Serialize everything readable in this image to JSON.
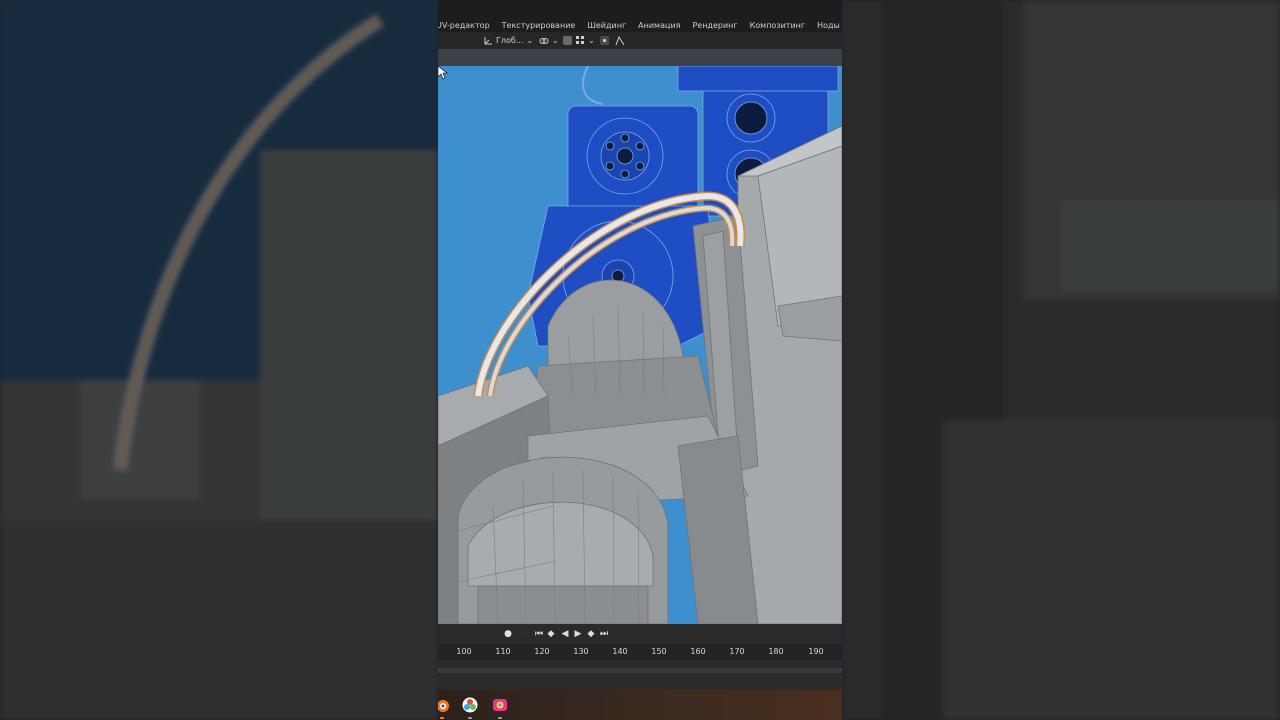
{
  "workspace_tabs": [
    "UV-редактор",
    "Текстурирование",
    "Шейдинг",
    "Анимация",
    "Рендеринг",
    "Композитинг",
    "Ноды геометрии"
  ],
  "header": {
    "transform_orientation": "Глоб...",
    "icons": [
      "transform-orientation-icon",
      "chevron-down-icon",
      "snap-link-icon",
      "chevron-down-icon",
      "proportional-edit-icon",
      "snap-grid-icon",
      "chevron-down-icon",
      "pivot-dot-icon",
      "falloff-curve-icon"
    ]
  },
  "timeline": {
    "ruler_ticks": [
      "100",
      "110",
      "120",
      "130",
      "140",
      "150",
      "160",
      "170",
      "180",
      "190"
    ],
    "playback_icons": [
      "record-icon",
      "jump-start-icon",
      "prev-keyframe-icon",
      "play-reverse-icon",
      "play-icon",
      "next-keyframe-icon",
      "jump-end-icon"
    ]
  },
  "taskbar": {
    "apps": [
      "blender-icon",
      "davinci-resolve-icon",
      "color-app-icon"
    ]
  },
  "colors": {
    "viewport_bg": "#3d8fce",
    "blueprint": "#1f4ec4",
    "mesh_gray": "#8f9396",
    "pipe_orange": "#c98a4a"
  }
}
